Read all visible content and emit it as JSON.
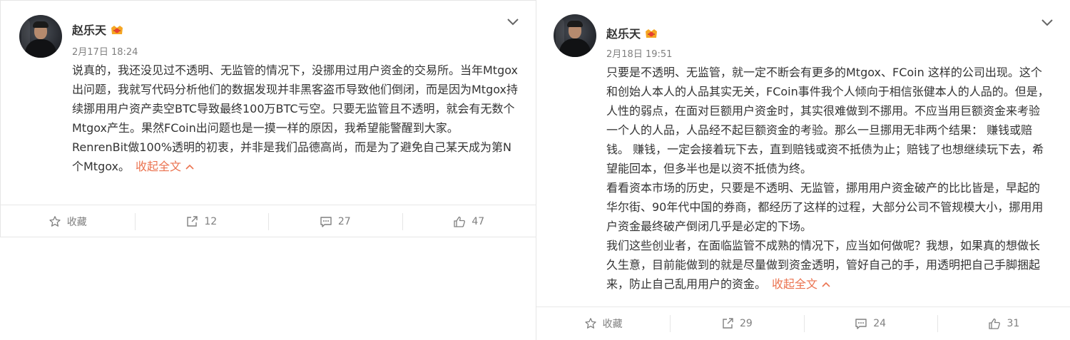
{
  "posts": [
    {
      "username": "赵乐天",
      "timestamp": "2月17日 18:24",
      "paragraphs": [
        "说真的，我还没见过不透明、无监管的情况下，没挪用过用户资金的交易所。当年Mtgox出问题，我就写代码分析他们的数据发现并非黑客盗币导致他们倒闭，而是因为Mtgox持续挪用用户资产卖空BTC导致最终100万BTC亏空。只要无监管且不透明，就会有无数个Mtgox产生。果然FCoin出问题也是一摸一样的原因，我希望能警醒到大家。",
        "RenrenBit做100%透明的初衷，并非是我们品德高尚，而是为了避免自己某天成为第N个Mtgox。"
      ],
      "collapse_label": "收起全文",
      "actions": {
        "favorite": "收藏",
        "repost": "12",
        "comment": "27",
        "like": "47"
      }
    },
    {
      "username": "赵乐天",
      "timestamp": "2月18日 19:51",
      "paragraphs": [
        "只要是不透明、无监管，就一定不断会有更多的Mtgox、FCoin 这样的公司出现。这个和创始人本人的人品其实无关，FCoin事件我个人倾向于相信张健本人的人品的。但是，人性的弱点，在面对巨额用户资金时，其实很难做到不挪用。不应当用巨额资金来考验一个人的人品，人品经不起巨额资金的考验。那么一旦挪用无非两个结果： 赚钱或赔钱。 赚钱，一定会接着玩下去，直到赔钱或资不抵债为止；赔钱了也想继续玩下去，希望能回本，但多半也是以资不抵债为终。",
        "看看资本市场的历史，只要是不透明、无监管，挪用用户资金破产的比比皆是，早起的华尔街、90年代中国的券商，都经历了这样的过程，大部分公司不管规模大小，挪用用户资金最终破产倒闭几乎是必定的下场。",
        "我们这些创业者，在面临监管不成熟的情况下，应当如何做呢？我想，如果真的想做长久生意，目前能做到的就是尽量做到资金透明，管好自己的手，用透明把自己手脚捆起来，防止自己乱用用户的资金。"
      ],
      "collapse_label": "收起全文",
      "actions": {
        "favorite": "收藏",
        "repost": "29",
        "comment": "24",
        "like": "31"
      }
    }
  ],
  "colors": {
    "link": "#eb7350",
    "muted": "#808080",
    "text": "#333333",
    "divider": "#e6e6e6"
  },
  "icons": [
    "chevron-down-icon",
    "vip-badge-icon",
    "star-icon",
    "repost-icon",
    "comment-icon",
    "thumbs-up-icon",
    "chevron-up-icon"
  ]
}
